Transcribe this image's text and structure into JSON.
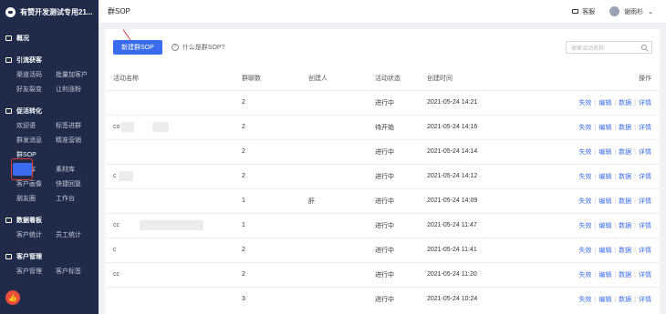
{
  "app": {
    "name": "有赞开发测试专用21..."
  },
  "sidebar": {
    "groups": [
      {
        "title": "概况",
        "items": []
      },
      {
        "title": "引流获客",
        "items": [
          "渠道活码",
          "批量加客户",
          "好友裂变",
          "让利涨粉"
        ]
      },
      {
        "title": "促活转化",
        "items": [
          "欢迎语",
          "标签进群",
          "群发消息",
          "精准营销",
          "群SOP",
          "",
          "知识库",
          "素材库",
          "客户画像",
          "快捷回复",
          "朋友圈",
          "工作台"
        ]
      },
      {
        "title": "数据看板",
        "items": [
          "客户统计",
          "员工统计"
        ]
      },
      {
        "title": "客户管理",
        "items": [
          "客户管理",
          "客户标签"
        ]
      }
    ]
  },
  "header": {
    "title": "群SOP",
    "service": "客服",
    "user": "谢雨杉"
  },
  "toolbar": {
    "new_button": "新建群SOP",
    "help": "什么是群SOP?",
    "search_placeholder": "搜索活动名称"
  },
  "table": {
    "columns": [
      "活动名称",
      "群聊数",
      "创建人",
      "活动状态",
      "创建时间",
      "操作"
    ],
    "rows": [
      {
        "prefix": "",
        "count": "2",
        "creator": "",
        "status": "进行中",
        "time": "2021-05-24 14:21",
        "ops": [
          "失效",
          "编辑",
          "数据",
          "详情"
        ]
      },
      {
        "prefix": "co",
        "count": "2",
        "creator": "",
        "status": "待开始",
        "time": "2021-05-24 14:16",
        "ops": [
          "失效",
          "编辑",
          "数据",
          "详情"
        ]
      },
      {
        "prefix": "",
        "count": "2",
        "creator": "",
        "status": "进行中",
        "time": "2021-05-24 14:14",
        "ops": [
          "失效",
          "编辑",
          "数据",
          "详情"
        ]
      },
      {
        "prefix": "c",
        "count": "2",
        "creator": "",
        "status": "进行中",
        "time": "2021-05-24 14:12",
        "ops": [
          "失效",
          "编辑",
          "数据",
          "详情"
        ]
      },
      {
        "prefix": "",
        "count": "1",
        "creator": "肝",
        "status": "进行中",
        "time": "2021-05-24 14:09",
        "ops": [
          "失效",
          "编辑",
          "数据",
          "详情"
        ]
      },
      {
        "prefix": "cc",
        "count": "1",
        "creator": "",
        "status": "进行中",
        "time": "2021-05-24 11:47",
        "ops": [
          "失效",
          "编辑",
          "数据",
          "详情"
        ]
      },
      {
        "prefix": "c",
        "count": "2",
        "creator": "",
        "status": "进行中",
        "time": "2021-05-24 11:41",
        "ops": [
          "失效",
          "编辑",
          "数据",
          "详情"
        ]
      },
      {
        "prefix": "cc",
        "count": "2",
        "creator": "",
        "status": "进行中",
        "time": "2021-05-24 11:20",
        "ops": [
          "失效",
          "编辑",
          "数据",
          "详情"
        ]
      },
      {
        "prefix": "",
        "count": "3",
        "creator": "",
        "status": "进行中",
        "time": "2021-05-24 10:24",
        "ops": [
          "失效",
          "编辑",
          "数据",
          "详情"
        ]
      }
    ]
  }
}
